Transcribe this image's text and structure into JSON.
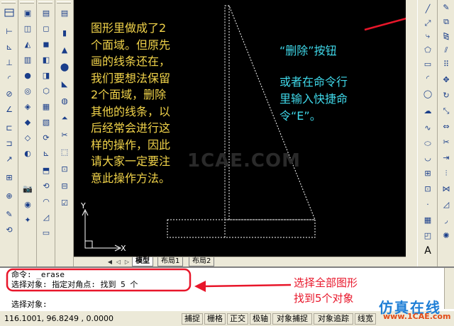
{
  "colors": {
    "annotation_left": "#f2d44a",
    "annotation_right": "#3fd7e8",
    "callout_red": "#e8162a",
    "canvas_bg": "#000000",
    "geometry": "#ffffff"
  },
  "canvas": {
    "left_annotation": "图形里做成了2\n个面域。但原先\n画的线条还在，\n我们要想法保留\n2个面域，删除\n其他的线条，以\n后经常会进行这\n样的操作，因此\n请大家一定要注\n意此操作方法。",
    "right_annotation_title": "“删除”按钮",
    "right_annotation_body": "或者在命令行\n里输入快捷命\n令“E”。",
    "watermark": "1CAE.COM",
    "axis_y": "Y",
    "axis_x": "X"
  },
  "tabs": {
    "model": "模型",
    "layout1": "布局1",
    "layout2": "布局2"
  },
  "command": {
    "line1": "命令: _erase",
    "line2": "选择对象: 指定对角点: 找到 5 个",
    "line3": "选择对象:",
    "callout": "选择全部图形\n找到5个对象"
  },
  "status": {
    "coords": "116.1001, 96.8249 , 0.0000",
    "buttons": [
      "捕捉",
      "栅格",
      "正交",
      "极轴",
      "对象捕捉",
      "对象追踪",
      "线宽"
    ]
  },
  "logo": {
    "text": "仿真在线",
    "url": "www.1CAE.com"
  }
}
